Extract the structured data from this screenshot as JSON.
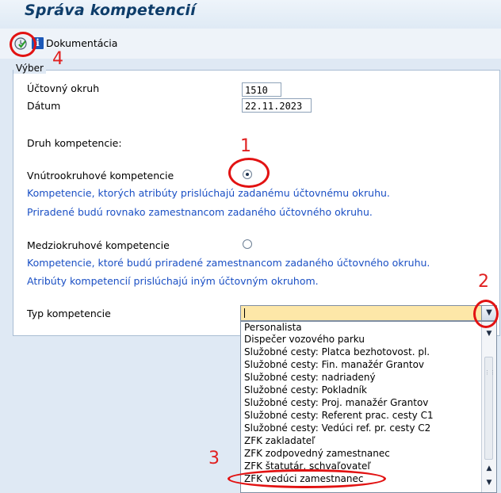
{
  "window": {
    "title": "Správa kompetencií"
  },
  "toolbar": {
    "execute_icon": "execute-clock-icon",
    "info_icon": "info-icon",
    "info_glyph": "i",
    "documentation_label": "Dokumentácia"
  },
  "selection": {
    "group_title": "Výber",
    "company_code_label": "Účtovný okruh",
    "company_code_value": "1510",
    "date_label": "Dátum",
    "date_value": "22.11.2023",
    "competence_kind_label": "Druh kompetencie:",
    "intra": {
      "label": "Vnútrookruhové kompetencie",
      "selected": true,
      "desc1": "Kompetencie, ktorých atribúty prislúchajú zadanému účtovnému okruhu.",
      "desc2": "Priradené budú rovnako zamestnancom zadaného účtovného okruhu."
    },
    "inter": {
      "label": "Medziokruhové kompetencie",
      "selected": false,
      "desc1": "Kompetencie, ktoré budú priradené zamestnancom zadaného účtovného okruhu.",
      "desc2": "Atribúty kompetencií prislúchajú iným účtovným okruhom."
    },
    "type_label": "Typ kompetencie",
    "type_value": ""
  },
  "dropdown_options": [
    "Personalista",
    "Dispečer vozového parku",
    "Služobné cesty: Platca bezhotovost. pl.",
    "Služobné cesty: Fin. manažér Grantov",
    "Služobné cesty: nadriadený",
    "Služobné cesty: Pokladník",
    "Služobné cesty: Proj. manažér Grantov",
    "Služobné cesty: Referent prac. cesty C1",
    "Služobné cesty: Vedúci ref. pr. cesty C2",
    "ZFK zakladateľ",
    "ZFK zodpovedný zamestnanec",
    "ZFK štatutár, schvaľovateľ",
    "ZFK vedúci zamestnanec"
  ],
  "annotations": {
    "n1": "1",
    "n2": "2",
    "n3": "3",
    "n4": "4"
  },
  "colors": {
    "annotation": "#e02020",
    "info_text": "#1a4fc4",
    "title": "#0e3d6a",
    "dropdown_bg": "#fde7a8"
  }
}
